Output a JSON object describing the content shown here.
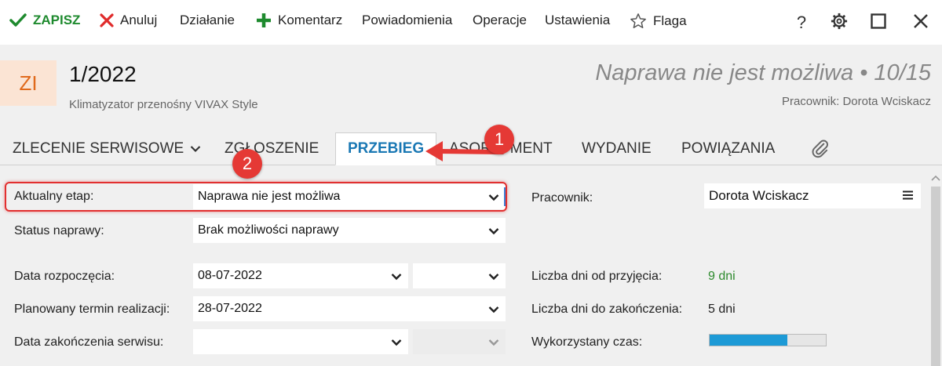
{
  "toolbar": {
    "save_label": "ZAPISZ",
    "cancel_label": "Anuluj",
    "action_label": "Działanie",
    "comment_label": "Komentarz",
    "notifications_label": "Powiadomienia",
    "operations_label": "Operacje",
    "settings_label": "Ustawienia",
    "flag_label": "Flaga",
    "help_label": "?"
  },
  "header": {
    "avatar_initials": "ZI",
    "doc_number": "1/2022",
    "description": "Klimatyzator przenośny VIVAX Style",
    "stage_title": "Naprawa nie jest możliwa • 10/15",
    "worker_line": "Pracownik: Dorota Wciskacz"
  },
  "tabs": [
    {
      "label": "ZLECENIE SERWISOWE"
    },
    {
      "label": "ZGŁOSZENIE"
    },
    {
      "label": "PRZEBIEG",
      "active": true
    },
    {
      "label": "ASORTYMENT"
    },
    {
      "label": "WYDANIE"
    },
    {
      "label": "POWIĄZANIA"
    }
  ],
  "form": {
    "stage_label": "Aktualny etap:",
    "stage_value": "Naprawa nie jest możliwa",
    "repair_status_label": "Status naprawy:",
    "repair_status_value": "Brak możliwości naprawy",
    "start_date_label": "Data rozpoczęcia:",
    "start_date_value": "08-07-2022",
    "start_time_value": "",
    "planned_label": "Planowany termin realizacji:",
    "planned_value": "28-07-2022",
    "end_date_label": "Data zakończenia serwisu:",
    "end_date_value": "",
    "end_time_value": "",
    "worker_label": "Pracownik:",
    "worker_value": "Dorota Wciskacz",
    "days_since_label": "Liczba dni od przyjęcia:",
    "days_since_value": "9 dni",
    "days_to_label": "Liczba dni do zakończenia:",
    "days_to_value": "5 dni",
    "time_used_label": "Wykorzystany czas:",
    "time_used_fraction": 0.67
  },
  "annotations": {
    "badge_1": "1",
    "badge_2": "2"
  },
  "colors": {
    "accent": "#1a78b4",
    "save_green": "#1e8a2e",
    "annotation_red": "#e53935",
    "progress_blue": "#1d9ad6"
  }
}
